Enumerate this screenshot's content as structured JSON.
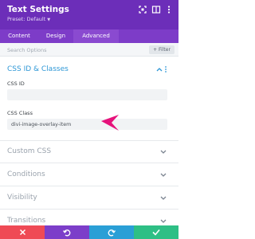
{
  "header": {
    "title": "Text Settings",
    "preset": "Preset: Default",
    "icons": [
      "fullscreen-icon",
      "split-view-icon",
      "more-vertical-icon"
    ]
  },
  "tabs": [
    {
      "label": "Content",
      "active": false
    },
    {
      "label": "Design",
      "active": false
    },
    {
      "label": "Advanced",
      "active": true
    }
  ],
  "search": {
    "placeholder": "Search Options",
    "filter_label": "Filter"
  },
  "sections": {
    "css_id_classes": {
      "title": "CSS ID & Classes",
      "css_id_label": "CSS ID",
      "css_id_value": "",
      "css_class_label": "CSS Class",
      "css_class_value": "divi-image-overlay-item"
    },
    "collapsed": [
      "Custom CSS",
      "Conditions",
      "Visibility",
      "Transitions"
    ]
  },
  "footer": {
    "buttons": [
      "close",
      "undo",
      "redo",
      "save"
    ],
    "colors": {
      "close": "#ef4a55",
      "undo": "#7c3ec9",
      "redo": "#2a9fd6",
      "save": "#2ebf85"
    }
  },
  "colors": {
    "header": "#6c2eb9",
    "tabs": "#7d3cc8",
    "accent": "#2d97d6",
    "pointer": "#e6127b"
  }
}
